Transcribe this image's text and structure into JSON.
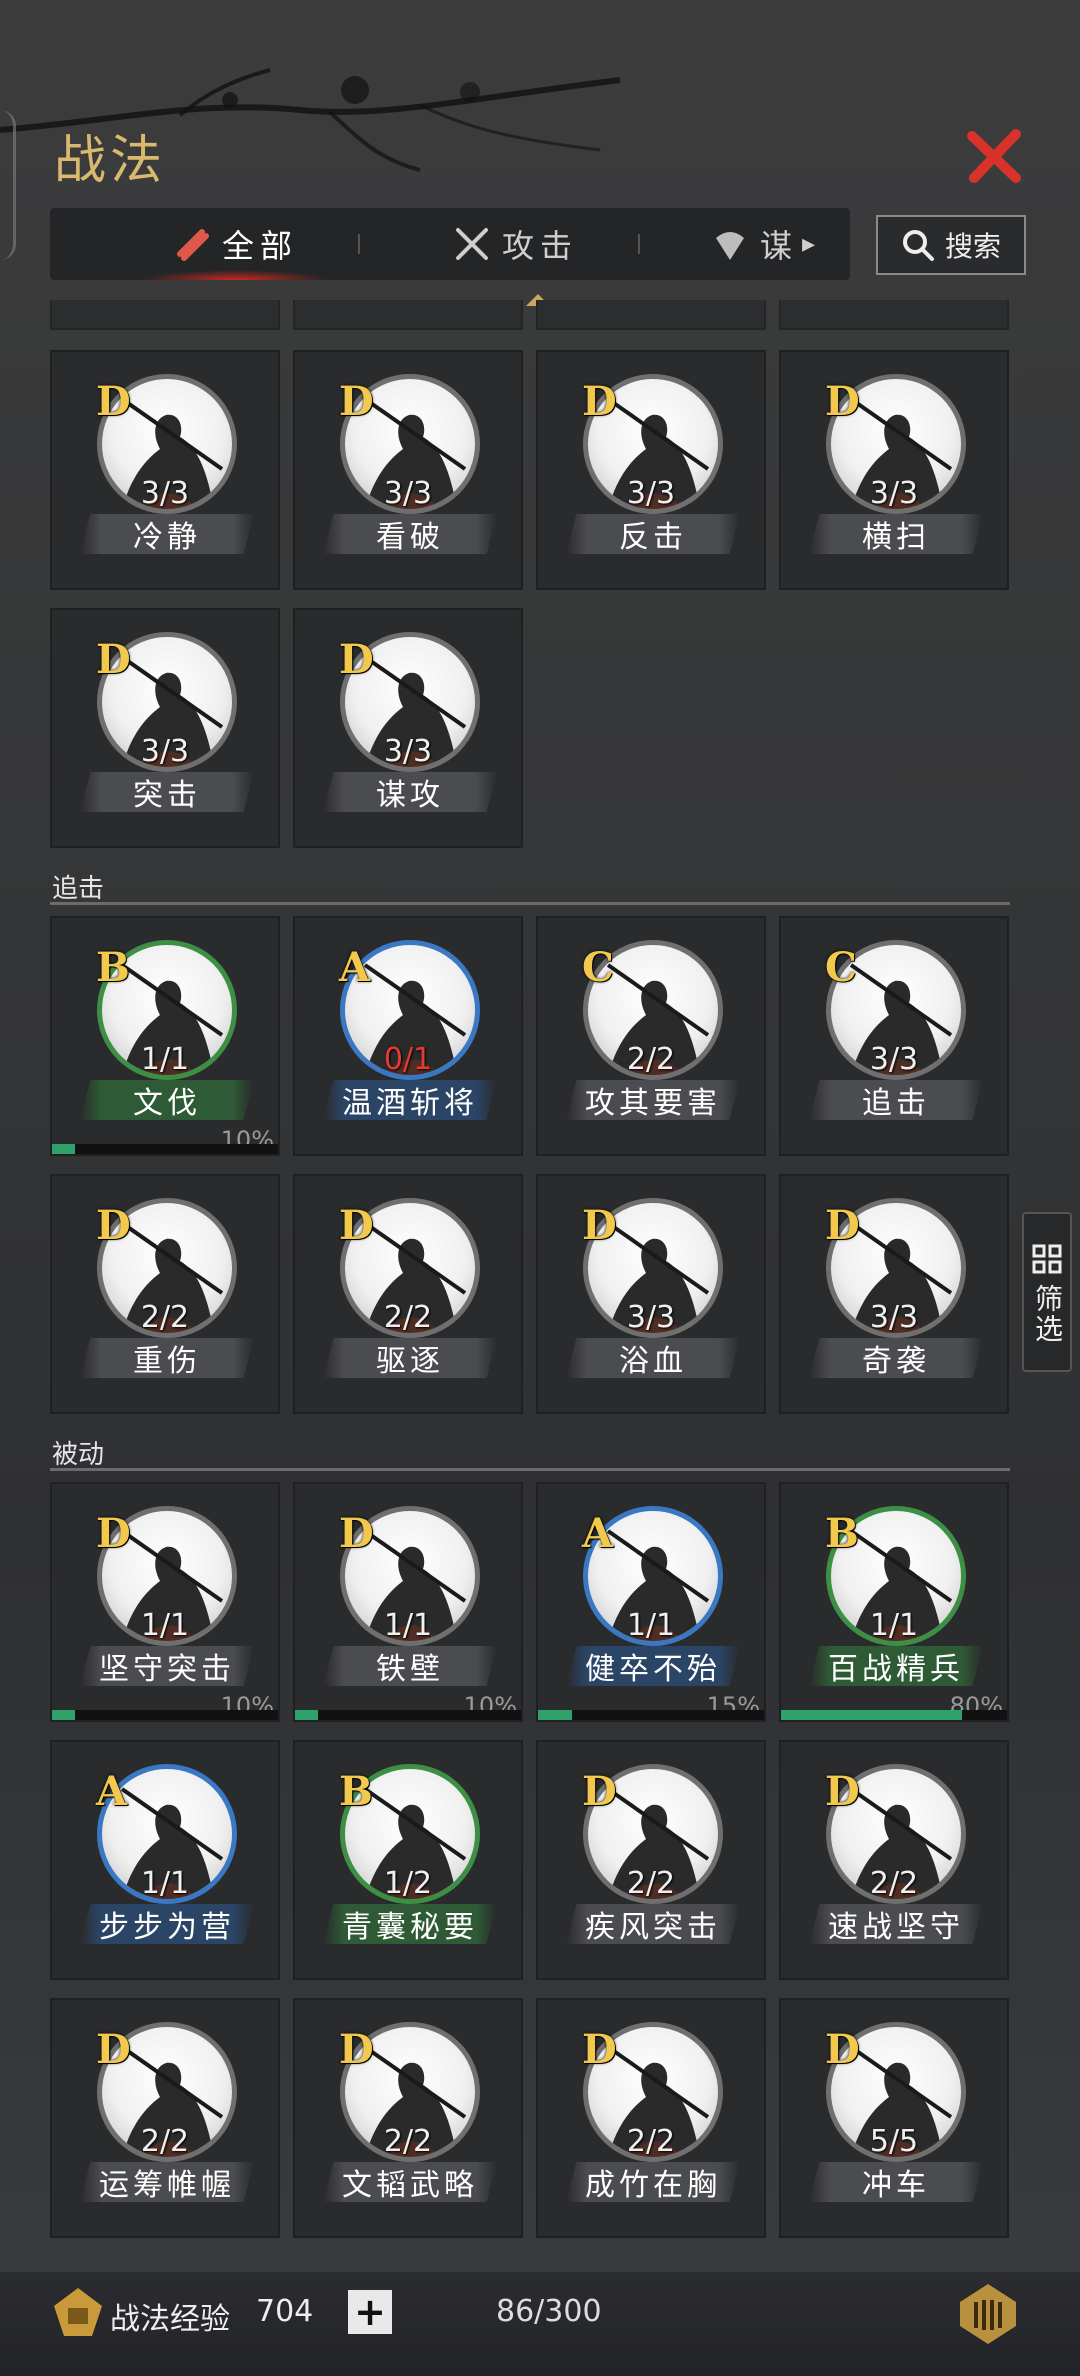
{
  "header": {
    "title": "战法"
  },
  "tabs": [
    {
      "label": "全部",
      "icon": "scroll-icon",
      "active": true
    },
    {
      "label": "攻击",
      "icon": "crossed-swords-icon",
      "active": false
    },
    {
      "label": "谋",
      "icon": "fan-icon",
      "active": false
    }
  ],
  "search": {
    "label": "搜索",
    "icon": "search-icon"
  },
  "filter": {
    "label": "筛选",
    "icon": "grid-icon"
  },
  "sections": {
    "pursuit": {
      "title": "追击"
    },
    "passive": {
      "title": "被动"
    }
  },
  "cards": [
    {
      "grade": "D",
      "count": "3/3",
      "name": "冷静"
    },
    {
      "grade": "D",
      "count": "3/3",
      "name": "看破"
    },
    {
      "grade": "D",
      "count": "3/3",
      "name": "反击"
    },
    {
      "grade": "D",
      "count": "3/3",
      "name": "横扫"
    },
    {
      "grade": "D",
      "count": "3/3",
      "name": "突击"
    },
    {
      "grade": "D",
      "count": "3/3",
      "name": "谋攻"
    },
    {
      "grade": "B",
      "count": "1/1",
      "name": "文伐",
      "percent": "10%",
      "progress": 0.1
    },
    {
      "grade": "A",
      "count": "0/1",
      "name": "温酒斩将"
    },
    {
      "grade": "C",
      "count": "2/2",
      "name": "攻其要害"
    },
    {
      "grade": "C",
      "count": "3/3",
      "name": "追击"
    },
    {
      "grade": "D",
      "count": "2/2",
      "name": "重伤"
    },
    {
      "grade": "D",
      "count": "2/2",
      "name": "驱逐"
    },
    {
      "grade": "D",
      "count": "3/3",
      "name": "浴血"
    },
    {
      "grade": "D",
      "count": "3/3",
      "name": "奇袭"
    },
    {
      "grade": "D",
      "count": "1/1",
      "name": "坚守突击",
      "percent": "10%",
      "progress": 0.1
    },
    {
      "grade": "D",
      "count": "1/1",
      "name": "铁壁",
      "percent": "10%",
      "progress": 0.1
    },
    {
      "grade": "A",
      "count": "1/1",
      "name": "健卒不殆",
      "percent": "15%",
      "progress": 0.15
    },
    {
      "grade": "B",
      "count": "1/1",
      "name": "百战精兵",
      "percent": "80%",
      "progress": 0.8
    },
    {
      "grade": "A",
      "count": "1/1",
      "name": "步步为营"
    },
    {
      "grade": "B",
      "count": "1/2",
      "name": "青囊秘要"
    },
    {
      "grade": "D",
      "count": "2/2",
      "name": "疾风突击"
    },
    {
      "grade": "D",
      "count": "2/2",
      "name": "速战坚守"
    },
    {
      "grade": "D",
      "count": "2/2",
      "name": "运筹帷幄"
    },
    {
      "grade": "D",
      "count": "2/2",
      "name": "文韬武略"
    },
    {
      "grade": "D",
      "count": "2/2",
      "name": "成竹在胸"
    },
    {
      "grade": "D",
      "count": "5/5",
      "name": "冲车"
    }
  ],
  "footer": {
    "exp_label": "战法经验",
    "exp_value": "704",
    "plus_label": "+",
    "capacity": "86/300"
  },
  "colors": {
    "title": "#d9b96d",
    "close": "#d8322a",
    "grade": "#f2c94c",
    "progress": "#2fa26b",
    "ring_green": "#3d8f45",
    "ring_blue": "#3a78c3"
  }
}
